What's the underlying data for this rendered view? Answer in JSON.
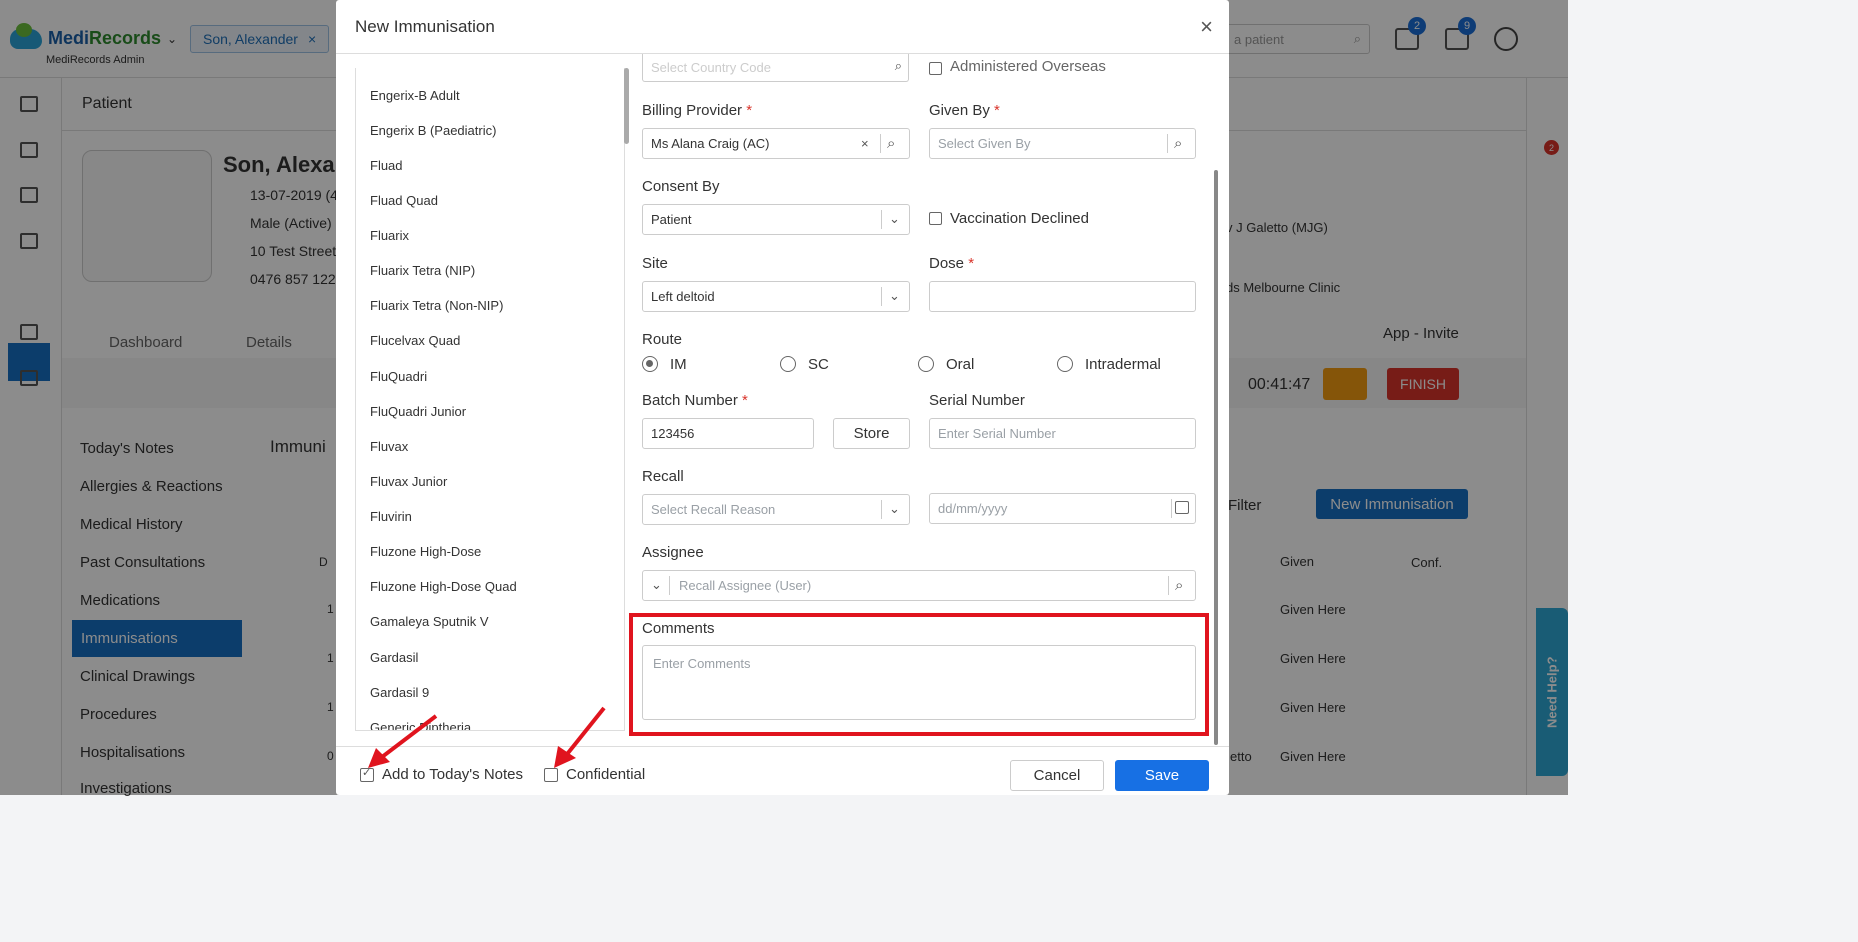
{
  "app": {
    "brand_a": "Medi",
    "brand_b": "Records",
    "subtitle": "MediRecords Admin"
  },
  "top": {
    "patient_pill": "Son, Alexander",
    "search_placeholder": "a patient",
    "mail_badge": "2",
    "tasks_badge": "9"
  },
  "patient": {
    "section_title": "Patient",
    "name": "Son, Alexa",
    "dob": "13-07-2019 (4",
    "gender": "Male (Active)",
    "address": "10 Test Street",
    "phone": "0476 857 122"
  },
  "tabs": [
    "Dashboard",
    "Details"
  ],
  "menu": [
    "Today's Notes",
    "Allergies & Reactions",
    "Medical History",
    "Past Consultations",
    "Medications",
    "Immunisations",
    "Clinical Drawings",
    "Procedures",
    "Hospitalisations",
    "Investigations"
  ],
  "background": {
    "immunisations_heading": "Immuni",
    "provider_partial": "v J Galetto (MJG)",
    "clinic_partial": "ds Melbourne Clinic",
    "app_invite": "App - Invite",
    "timer": "00:41:47",
    "finish": "FINISH",
    "filter": "Filter",
    "new_immunisation": "New Immunisation",
    "col_given": "Given",
    "col_conf": "Conf.",
    "col_date": "D",
    "given_here": "Given Here",
    "row_dates": [
      "1",
      "1",
      "1",
      "0"
    ],
    "galetto_partial": "etto",
    "need_help": "Need Help?",
    "right_badge": "2"
  },
  "modal": {
    "title": "New Immunisation",
    "vaccines": [
      "Engerix-B Adult",
      "Engerix B (Paediatric)",
      "Fluad",
      "Fluad Quad",
      "Fluarix",
      "Fluarix Tetra (NIP)",
      "Fluarix Tetra (Non-NIP)",
      "Flucelvax Quad",
      "FluQuadri",
      "FluQuadri Junior",
      "Fluvax",
      "Fluvax Junior",
      "Fluvirin",
      "Fluzone High-Dose",
      "Fluzone High-Dose Quad",
      "Gamaleya Sputnik V",
      "Gardasil",
      "Gardasil 9",
      "Generic Diptheria"
    ],
    "country_code_placeholder": "Select Country Code",
    "administered_overseas": "Administered Overseas",
    "billing_provider_label": "Billing Provider",
    "billing_provider_value": "Ms Alana Craig (AC)",
    "given_by_label": "Given By",
    "given_by_placeholder": "Select Given By",
    "consent_by_label": "Consent By",
    "consent_by_value": "Patient",
    "vaccination_declined": "Vaccination Declined",
    "site_label": "Site",
    "site_value": "Left deltoid",
    "dose_label": "Dose",
    "route_label": "Route",
    "routes": [
      "IM",
      "SC",
      "Oral",
      "Intradermal"
    ],
    "batch_label": "Batch Number",
    "batch_value": "123456",
    "store_label": "Store",
    "serial_label": "Serial Number",
    "serial_placeholder": "Enter Serial Number",
    "recall_label": "Recall",
    "recall_placeholder": "Select Recall Reason",
    "date_placeholder": "dd/mm/yyyy",
    "assignee_label": "Assignee",
    "assignee_placeholder": "Recall Assignee (User)",
    "comments_label": "Comments",
    "comments_placeholder": "Enter Comments",
    "add_to_notes": "Add to Today's Notes",
    "confidential": "Confidential",
    "cancel": "Cancel",
    "save": "Save",
    "required_mark": "*"
  },
  "colors": {
    "primary": "#1770c4",
    "save": "#1770e4",
    "finish": "#d9342b",
    "pause": "#f39c12",
    "annotation": "#e0141e"
  }
}
